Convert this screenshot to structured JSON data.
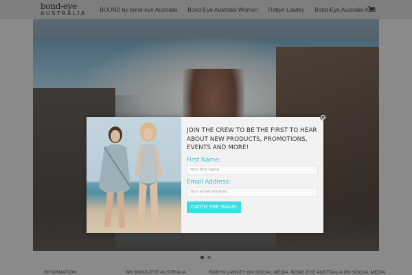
{
  "header": {
    "logo_main": "bond-eye",
    "logo_sub": "AUSTRALIA",
    "nav": [
      {
        "label": "BOUND by bond-eye Australia"
      },
      {
        "label": "Bond-Eye Australia Women"
      },
      {
        "label": "Robyn Lawley"
      },
      {
        "label": "Bond-Eye Australia Kids"
      }
    ],
    "cart_icon": "shopping-cart-icon"
  },
  "popup": {
    "heading": "JOIN THE CREW TO BE THE FIRST TO HEAR ABOUT NEW PRODUCTS, PROMOTIONS, EVENTS AND MORE!",
    "first_name_label": "First Name:",
    "first_name_placeholder": "Your first name",
    "email_label": "Email Address:",
    "email_placeholder": "Your email address",
    "submit_label": "CATCH THE WAVE!",
    "close_icon": "close-icon",
    "accent_color": "#3fdde3"
  },
  "slider": {
    "dots": [
      {
        "active": true
      },
      {
        "active": false
      }
    ]
  },
  "footer": {
    "columns": [
      {
        "title": "INFORMATION"
      },
      {
        "title": "MY BOND-EYE AUSTRALIA"
      },
      {
        "title": "ROBYN LAWLEY ON SOCIAL MEDIA"
      },
      {
        "title": "BOND-EYE AUSTRALIA ON SOCIAL MEDIA"
      }
    ]
  }
}
